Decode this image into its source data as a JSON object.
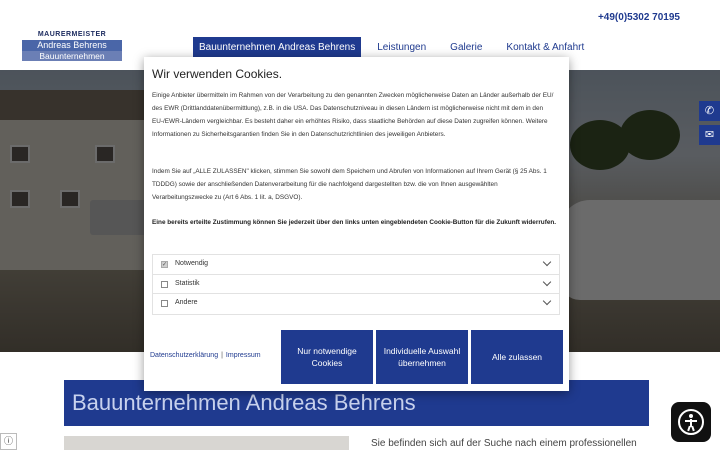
{
  "logo": {
    "line1": "MAURERMEISTER",
    "line2": "Andreas Behrens",
    "line3": "Bauunternehmen"
  },
  "header": {
    "phone": "+49(0)5302 70195"
  },
  "nav": {
    "items": [
      "Bauunternehmen Andreas Behrens",
      "Leistungen",
      "Galerie",
      "Kontakt & Anfahrt"
    ],
    "active": 0
  },
  "side": {
    "phone_icon": "phone-icon",
    "mail_icon": "envelope-icon"
  },
  "content": {
    "title": "Bauunternehmen Andreas Behrens",
    "intro": "Sie befinden sich auf der Suche nach einem professionellen"
  },
  "cookie": {
    "title": "Wir verwenden Cookies.",
    "p1": "Einige Anbieter übermitteln im Rahmen von der Verarbeitung zu den genannten Zwecken möglicherweise Daten an Länder außerhalb der EU/ des EWR (Drittlanddatenübermittlung), z.B. in die USA. Das Datenschutzniveau in diesen Ländern ist möglicherweise nicht mit dem in den EU-/EWR-Ländern vergleichbar. Es besteht daher ein erhöhtes Risiko, dass staatliche Behörden auf diese Daten zugreifen können. Weitere Informationen zu Sicherheitsgarantien finden Sie in den Datenschutzrichtlinien des jeweiligen Anbieters.",
    "p2": "Indem Sie auf „ALLE ZULASSEN\" klicken, stimmen Sie sowohl dem Speichern und Abrufen von Informationen auf Ihrem Gerät (§ 25 Abs. 1 TDDDG) sowie der anschließenden Datenverarbeitung für die nachfolgend dargestellten bzw. die von Ihnen ausgewählten Verarbeitungszwecke zu (Art 6 Abs. 1 lit. a, DSGVO).",
    "p3": "Eine bereits erteilte Zustimmung können Sie jederzeit über den links unten eingeblendeten Cookie-Button für die Zukunft widerrufen.",
    "categories": [
      {
        "label": "Notwendig",
        "checked": true
      },
      {
        "label": "Statistik",
        "checked": false
      },
      {
        "label": "Andere",
        "checked": false
      }
    ],
    "link_privacy": "Datenschutzerklärung",
    "link_sep": "|",
    "link_imprint": "Impressum",
    "btn_necessary": "Nur notwendige Cookies",
    "btn_individual": "Individuelle Auswahl übernehmen",
    "btn_all": "Alle zulassen"
  },
  "colors": {
    "primary": "#1f3a8f",
    "overlay": "rgba(0,0,0,0.55)"
  }
}
